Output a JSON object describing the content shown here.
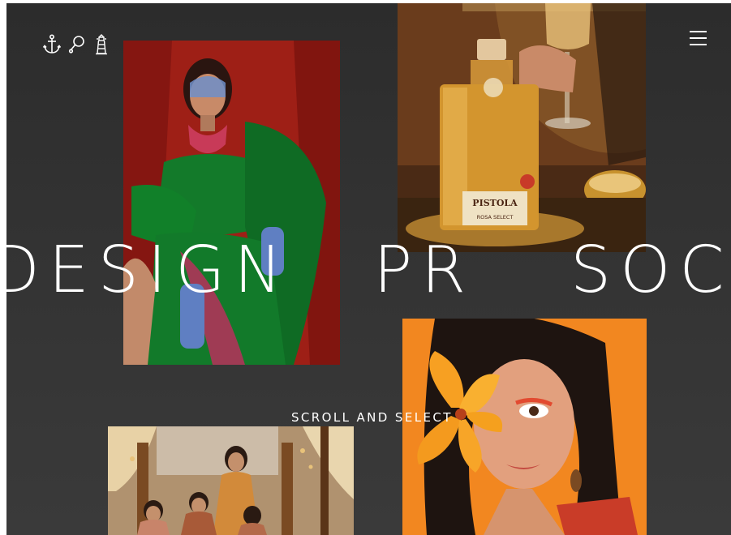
{
  "marquee": {
    "word1": "DESIGN",
    "word2": "PR",
    "word3": "SOCI"
  },
  "scroll_hint": "SCROLL AND SELECT",
  "nav": {
    "icons": [
      "anchor-icon",
      "magnifier-icon",
      "lighthouse-icon"
    ],
    "menu_icon": "hamburger-menu-icon"
  },
  "cards": {
    "saree": {
      "alt": "Model in green silk saree with jewelry"
    },
    "bottle": {
      "alt": "Pistola Rosa Select bottle with champagne glass",
      "label_brand": "PISTOLA",
      "label_variant": "ROSA SELECT"
    },
    "portrait": {
      "alt": "Woman holding orange lily over eye"
    },
    "wedding": {
      "alt": "Bridal group in decorated room"
    }
  },
  "colors": {
    "background": "#333333",
    "text": "#ffffff"
  }
}
